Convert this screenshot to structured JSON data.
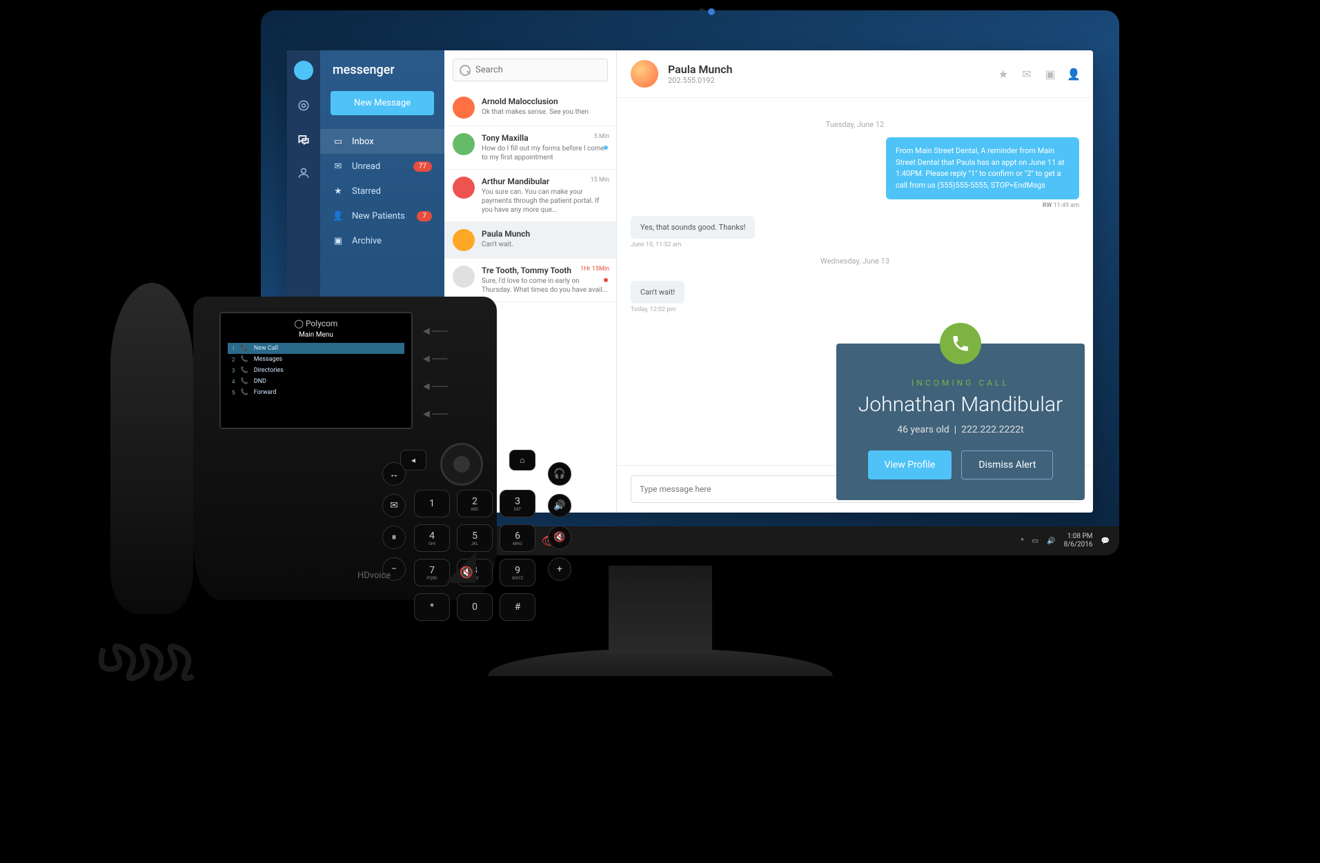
{
  "app_title": "messenger",
  "new_message_btn": "New Message",
  "nav": [
    {
      "icon": "inbox",
      "label": "Inbox",
      "badge": null,
      "active": true
    },
    {
      "icon": "mail",
      "label": "Unread",
      "badge": "77"
    },
    {
      "icon": "star",
      "label": "Starred",
      "badge": null
    },
    {
      "icon": "user-plus",
      "label": "New Patients",
      "badge": "7"
    },
    {
      "icon": "archive",
      "label": "Archive",
      "badge": null
    }
  ],
  "search": {
    "placeholder": "Search"
  },
  "threads": [
    {
      "name": "Arnold Malocclusion",
      "preview": "Ok that makes sense. See you then",
      "time": "",
      "dot": "",
      "avatarColor": "#ff7043"
    },
    {
      "name": "Tony Maxilla",
      "preview": "How do I fill out my forms before I come to my first appointment",
      "time": "5 Min",
      "dot": "blue",
      "avatarColor": "#66bb6a"
    },
    {
      "name": "Arthur Mandibular",
      "preview": "You sure can. You can make your payments through the patient portal. If you have any more que...",
      "time": "15 Min",
      "dot": "",
      "avatarColor": "#ef5350"
    },
    {
      "name": "Paula Munch",
      "preview": "Can't wait.",
      "time": "",
      "dot": "",
      "selected": true,
      "avatarColor": "#ffa726"
    },
    {
      "name": "Tre Tooth, Tommy Tooth",
      "preview": "Sure, I'd love to come in early on Thursday. What times do you have avail...",
      "time": "1Hr 15Min",
      "dot": "red",
      "urgent": true,
      "avatarColor": "#e0e0e0"
    }
  ],
  "conversation": {
    "contact_name": "Paula Munch",
    "contact_phone": "202.555.0192",
    "divider1": "Tuesday, June 12",
    "msg_out": "From Main Street Dental,\nA reminder from Main Street Dental that Paula has an appt on June 11 at 1:40PM. Please reply \"1\" to confirm or \"2\" to get a call from us (555)555-5555, STOP=EndMsgs",
    "msg_out_author": "RW",
    "msg_out_time": "11:49 am",
    "msg_in1": "Yes, that sounds good. Thanks!",
    "msg_in1_meta": "June 10, 11:52 am",
    "divider2": "Wednesday, June 13",
    "msg_in2": "Can't wait!",
    "msg_in2_meta": "Today, 12:02 pm",
    "compose_placeholder": "Type message here"
  },
  "call": {
    "label": "INCOMING CALL",
    "name": "Johnathan Mandibular",
    "age": "46 years old",
    "sep": "|",
    "phone": "222.222.2222t",
    "btn_view": "View Profile",
    "btn_dismiss": "Dismiss Alert"
  },
  "taskbar": {
    "time": "1:08 PM",
    "date": "8/6/2016"
  },
  "phone_device": {
    "brand": "Polycom",
    "menu_title": "Main Menu",
    "items": [
      {
        "n": "1",
        "label": "New Call",
        "sel": true
      },
      {
        "n": "2",
        "label": "Messages"
      },
      {
        "n": "3",
        "label": "Directories"
      },
      {
        "n": "4",
        "label": "DND"
      },
      {
        "n": "5",
        "label": "Forward"
      }
    ],
    "hd": "HDvoice"
  },
  "keypad": [
    "1",
    "2",
    "3",
    "4",
    "5",
    "6",
    "7",
    "8",
    "9",
    "*",
    "0",
    "#"
  ],
  "keypad_sub": [
    "",
    "ABC",
    "DEF",
    "GHI",
    "JKL",
    "MNO",
    "PQRS",
    "TUV",
    "WXYZ",
    "",
    "",
    ""
  ]
}
